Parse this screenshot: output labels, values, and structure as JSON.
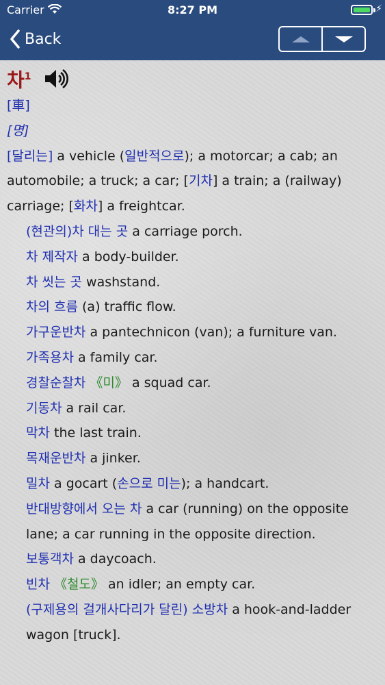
{
  "status": {
    "carrier": "Carrier",
    "time": "8:27 PM",
    "battery_level": 1.0
  },
  "nav": {
    "back_label": "Back",
    "up_icon": "triangle-up-icon",
    "down_icon": "triangle-down-icon"
  },
  "entry": {
    "headword": "차",
    "homograph": "1",
    "hanja": "[車]",
    "pos": "[명]",
    "def": {
      "p1": "[달리는]",
      "t1": " a vehicle (",
      "p2": "일반적으로",
      "t2": "); a motorcar; a cab; an automobile; a truck; a car; [",
      "p3": "기차",
      "t3": "] a train; a (railway) carriage; [",
      "p4": "화차",
      "t4": "] a freightcar."
    },
    "examples": [
      {
        "ko": "(현관의)차 대는 곳",
        "en": " a carriage porch."
      },
      {
        "ko": "차 제작자",
        "en": " a body-builder."
      },
      {
        "ko": "차 씻는 곳",
        "en": " washstand."
      },
      {
        "ko": "차의 흐름",
        "en": " (a) traffic flow."
      },
      {
        "ko": "가구운반차",
        "en": " a pantechnicon (van); a furniture van."
      },
      {
        "ko": "가족용차",
        "en": " a family car."
      },
      {
        "ko": "경찰순찰차",
        "tag": " 《미》",
        "en": " a squad car."
      },
      {
        "ko": "기동차",
        "en": " a rail car."
      },
      {
        "ko": "막차",
        "en": " the last train."
      },
      {
        "ko": "목재운반차",
        "en": " a jinker."
      },
      {
        "ko": "밀차",
        "en": " a gocart (",
        "ko2": "손으로 미는",
        "en2": "); a handcart."
      },
      {
        "ko": "반대방향에서 오는 차",
        "en": " a car (running) on the opposite lane; a car running in the opposite direction."
      },
      {
        "ko": "보통객차",
        "en": " a daycoach."
      },
      {
        "ko": "빈차",
        "tag": " 《철도》",
        "en": " an idler; an empty car."
      },
      {
        "ko": "(구제용의 걸개사다리가 달린) 소방차",
        "en": " a hook-and-ladder wagon [truck]."
      }
    ]
  }
}
